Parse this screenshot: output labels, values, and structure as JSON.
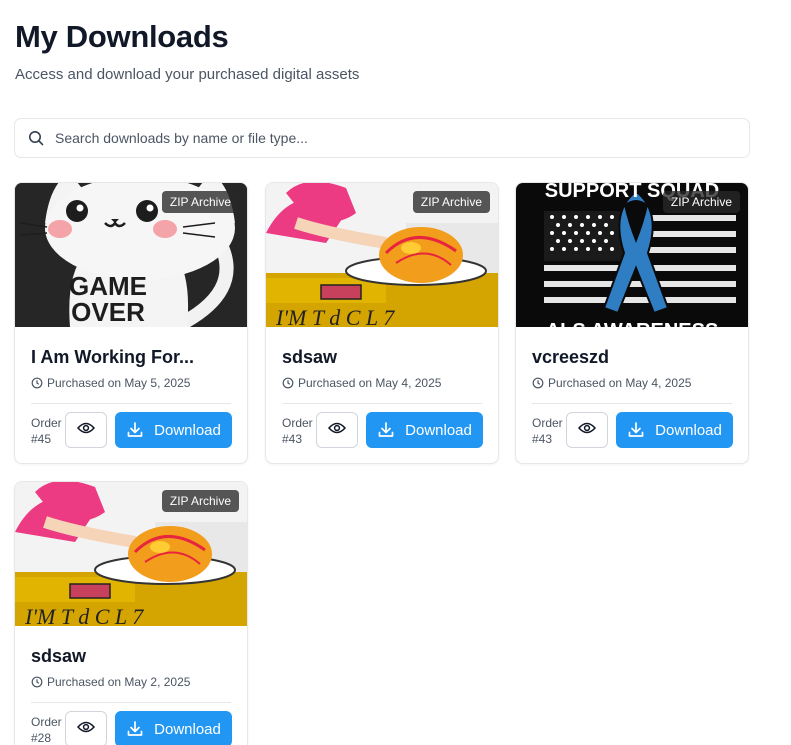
{
  "header": {
    "title": "My Downloads",
    "subtitle": "Access and download your purchased digital assets"
  },
  "search": {
    "placeholder": "Search downloads by name or file type...",
    "icon": "search-icon"
  },
  "cards": [
    {
      "title": "I Am Working For...",
      "badge": "ZIP Archive",
      "date": "Purchased on May 5, 2025",
      "order_label": "Order",
      "order_number": "#45",
      "download_label": "Download",
      "thumbnail": "cat-game-over"
    },
    {
      "title": "sdsaw",
      "badge": "ZIP Archive",
      "date": "Purchased on May 4, 2025",
      "order_label": "Order",
      "order_number": "#43",
      "download_label": "Download",
      "thumbnail": "turkey-cooking"
    },
    {
      "title": "vcreeszd",
      "badge": "ZIP Archive",
      "date": "Purchased on May 4, 2025",
      "order_label": "Order",
      "order_number": "#43",
      "download_label": "Download",
      "thumbnail": "support-squad-ribbon"
    },
    {
      "title": "sdsaw",
      "badge": "ZIP Archive",
      "date": "Purchased on May 2, 2025",
      "order_label": "Order",
      "order_number": "#28",
      "download_label": "Download",
      "thumbnail": "turkey-cooking"
    }
  ],
  "colors": {
    "accent": "#2196f3",
    "text": "#111827",
    "muted": "#4b5563",
    "border": "#e5e7eb"
  }
}
